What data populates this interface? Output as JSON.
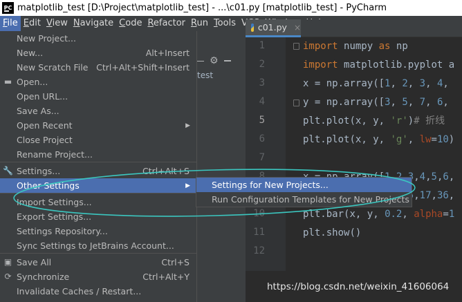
{
  "window": {
    "title": "matplotlib_test [D:\\Project\\matplotlib_test] - ...\\c01.py [matplotlib_test] - PyCharm",
    "app_icon_text": "PC"
  },
  "menubar": [
    {
      "label": "File",
      "u": "F",
      "rest": "ile",
      "active": true
    },
    {
      "label": "Edit",
      "u": "E",
      "rest": "dit"
    },
    {
      "label": "View",
      "u": "V",
      "rest": "iew"
    },
    {
      "label": "Navigate",
      "u": "N",
      "rest": "avigate"
    },
    {
      "label": "Code",
      "u": "C",
      "rest": "ode"
    },
    {
      "label": "Refactor",
      "u": "R",
      "rest": "efactor"
    },
    {
      "label": "Run",
      "u": "R",
      "rest": "un"
    },
    {
      "label": "Tools",
      "u": "T",
      "rest": "ools"
    },
    {
      "label": "VCS",
      "u": "S",
      "pre": "VC",
      "rest": ""
    },
    {
      "label": "Window",
      "u": "W",
      "rest": "indow"
    },
    {
      "label": "Help",
      "u": "H",
      "rest": "elp"
    }
  ],
  "file_menu": {
    "items": [
      {
        "label": "New Project...",
        "shortcut": ""
      },
      {
        "label": "New...",
        "shortcut": "Alt+Insert"
      },
      {
        "label": "New Scratch File",
        "shortcut": "Ctrl+Alt+Shift+Insert"
      },
      {
        "label": "Open...",
        "shortcut": "",
        "icon": "folder-icon"
      },
      {
        "label": "Open URL...",
        "shortcut": ""
      },
      {
        "label": "Save As...",
        "shortcut": ""
      },
      {
        "label": "Open Recent",
        "shortcut": "",
        "submenu": true
      },
      {
        "label": "Close Project",
        "shortcut": ""
      },
      {
        "label": "Rename Project...",
        "shortcut": ""
      },
      {
        "label": "Settings...",
        "shortcut": "Ctrl+Alt+S",
        "icon": "wrench-icon"
      },
      {
        "label": "Other Settings",
        "shortcut": "",
        "submenu": true,
        "highlighted": true
      },
      {
        "label": "Import Settings...",
        "shortcut": ""
      },
      {
        "label": "Export Settings...",
        "shortcut": ""
      },
      {
        "label": "Settings Repository...",
        "shortcut": ""
      },
      {
        "label": "Sync Settings to JetBrains Account...",
        "shortcut": ""
      },
      {
        "label": "Save All",
        "shortcut": "Ctrl+S",
        "icon": "save-icon"
      },
      {
        "label": "Synchronize",
        "shortcut": "Ctrl+Alt+Y",
        "icon": "sync-icon"
      },
      {
        "label": "Invalidate Caches / Restart...",
        "shortcut": ""
      }
    ]
  },
  "other_settings_submenu": [
    {
      "label": "Settings for New Projects...",
      "highlighted": true
    },
    {
      "label": "Run Configuration Templates for New Projects"
    }
  ],
  "project_pane": {
    "tree_item": "test"
  },
  "editor": {
    "tab_label": "c01.py",
    "current_line": 5,
    "line_numbers": [
      "1",
      "2",
      "3",
      "4",
      "5",
      "6",
      "7",
      "8",
      "9",
      "10",
      "11",
      "12"
    ],
    "code_lines": [
      "import numpy as np",
      "import matplotlib.pyplot a",
      "x = np.array([1, 2, 3, 4,",
      "y = np.array([3, 5, 7, 6,",
      "plt.plot(x, y, 'r')# 折线",
      "plt.plot(x, y, 'g', lw=10)",
      "",
      "x = np.array([1,2,3,4,5,6,",
      "y = np.array([13,25,17,36,",
      "plt.bar(x, y, 0.2, alpha=1",
      "plt.show()",
      ""
    ]
  },
  "watermark": "https://blog.csdn.net/weixin_41606064",
  "colors": {
    "highlight": "#4b6eaf",
    "annotation": "#3bc7c0",
    "keyword": "#cc7832",
    "string": "#6a8759",
    "number": "#6897bb"
  }
}
